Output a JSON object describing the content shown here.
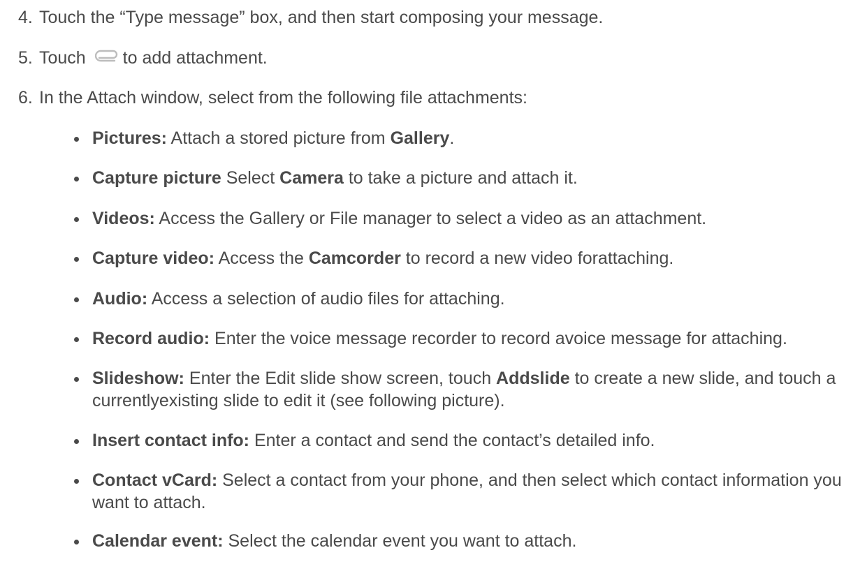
{
  "steps": [
    {
      "num": "4.",
      "text": "Touch the “Type message” box, and then start composing your message."
    },
    {
      "num": "5.",
      "before": "Touch",
      "after": "to add attachment.",
      "icon": "paperclip-icon"
    },
    {
      "num": "6.",
      "text": "In the Attach window, select from the following file attachments:"
    }
  ],
  "attachments": [
    {
      "parts": [
        {
          "b": "Pictures:"
        },
        {
          "t": " Attach a stored picture from "
        },
        {
          "b": "Gallery"
        },
        {
          "t": "."
        }
      ]
    },
    {
      "parts": [
        {
          "b": "Capture picture"
        },
        {
          "t": " Select "
        },
        {
          "b": "Camera"
        },
        {
          "t": " to take a picture and attach it."
        }
      ]
    },
    {
      "parts": [
        {
          "b": "Videos:"
        },
        {
          "t": " Access the Gallery or File manager to select a video as an attachment."
        }
      ]
    },
    {
      "parts": [
        {
          "b": "Capture video:"
        },
        {
          "t": "  Access the "
        },
        {
          "b": "Camcorder"
        },
        {
          "t": "  to record a new video forattaching."
        }
      ]
    },
    {
      "parts": [
        {
          "b": "Audio:"
        },
        {
          "t": " Access a selection of audio files for attaching."
        }
      ]
    },
    {
      "parts": [
        {
          "b": "Record audio:"
        },
        {
          "t": "  Enter the voice message recorder to record avoice message for attaching."
        }
      ]
    },
    {
      "parts": [
        {
          "b": "Slideshow:"
        },
        {
          "t": "  Enter the Edit slide show screen, touch "
        },
        {
          "b": "Addslide"
        },
        {
          "t": " to create a new slide, and touch a currentlyexisting slide to edit it (see following picture)."
        }
      ]
    },
    {
      "parts": [
        {
          "b": "Insert contact info:"
        },
        {
          "t": "  Enter a contact and send the contact’s detailed info."
        }
      ]
    },
    {
      "parts": [
        {
          "b": "Contact vCard:"
        },
        {
          "t": "  Select a contact from your phone, and then select which contact information you want to attach."
        }
      ]
    },
    {
      "parts": [
        {
          "b": "Calendar event:"
        },
        {
          "t": "  Select the calendar event you want to attach."
        }
      ]
    }
  ]
}
